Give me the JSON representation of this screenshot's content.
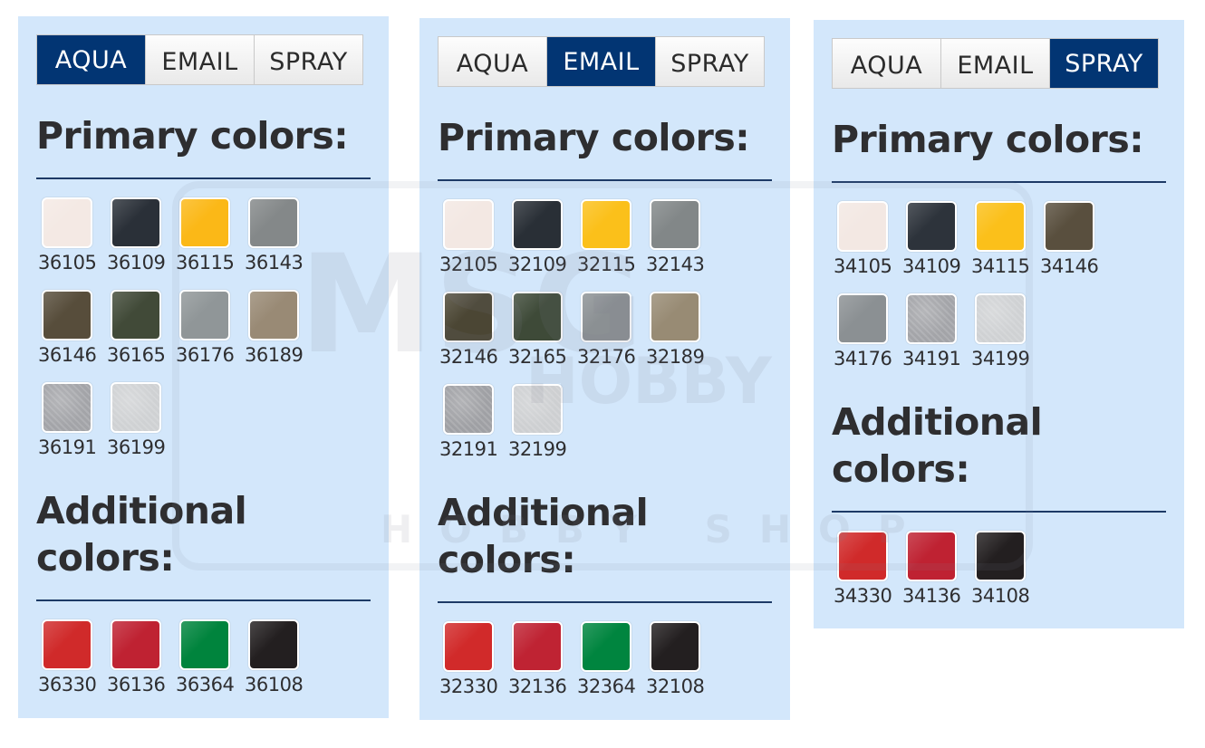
{
  "watermark": {
    "brand_top": "MSG",
    "brand_mid": "HOBBY",
    "brand_bottom": "HOBBY SHOP"
  },
  "panels": [
    {
      "tabs": [
        {
          "label": "AQUA",
          "active": true
        },
        {
          "label": "EMAIL",
          "active": false
        },
        {
          "label": "SPRAY",
          "active": false
        }
      ],
      "primary_heading": "Primary colors:",
      "additional_heading_line1": "Additional",
      "additional_heading_line2": "colors:",
      "primary": [
        {
          "code": "36105",
          "color": "#f4e9e4"
        },
        {
          "code": "36109",
          "color": "#2a3038"
        },
        {
          "code": "36115",
          "color": "#fbb817"
        },
        {
          "code": "36143",
          "color": "#848889"
        },
        {
          "code": "36146",
          "color": "#574d3b"
        },
        {
          "code": "36165",
          "color": "#414a38"
        },
        {
          "code": "36176",
          "color": "#909698"
        },
        {
          "code": "36189",
          "color": "#998a75"
        },
        {
          "code": "36191",
          "color": "#a3a4a8",
          "metallic": true
        },
        {
          "code": "36199",
          "color": "#cfd1d3",
          "metallic": true
        }
      ],
      "additional": [
        {
          "code": "36330",
          "color": "#d02a2a"
        },
        {
          "code": "36136",
          "color": "#bf2232"
        },
        {
          "code": "36364",
          "color": "#00843d"
        },
        {
          "code": "36108",
          "color": "#231f20"
        }
      ]
    },
    {
      "tabs": [
        {
          "label": "AQUA",
          "active": false
        },
        {
          "label": "EMAIL",
          "active": true
        },
        {
          "label": "SPRAY",
          "active": false
        }
      ],
      "primary_heading": "Primary colors:",
      "additional_heading_line1": "Additional",
      "additional_heading_line2": "colors:",
      "primary": [
        {
          "code": "32105",
          "color": "#f3e8e3"
        },
        {
          "code": "32109",
          "color": "#292f36"
        },
        {
          "code": "32115",
          "color": "#fbc01a"
        },
        {
          "code": "32143",
          "color": "#828788"
        },
        {
          "code": "32146",
          "color": "#4b4634"
        },
        {
          "code": "32165",
          "color": "#3e4a38"
        },
        {
          "code": "32176",
          "color": "#8b9093"
        },
        {
          "code": "32189",
          "color": "#988b74"
        },
        {
          "code": "32191",
          "color": "#9fa0a4",
          "metallic": true
        },
        {
          "code": "32199",
          "color": "#cdcfd1",
          "metallic": true
        }
      ],
      "additional": [
        {
          "code": "32330",
          "color": "#d12a2a"
        },
        {
          "code": "32136",
          "color": "#bf2333"
        },
        {
          "code": "32364",
          "color": "#00853f"
        },
        {
          "code": "32108",
          "color": "#231f20"
        }
      ]
    },
    {
      "tabs": [
        {
          "label": "AQUA",
          "active": false
        },
        {
          "label": "EMAIL",
          "active": false
        },
        {
          "label": "SPRAY",
          "active": true
        }
      ],
      "primary_heading": "Primary colors:",
      "additional_heading_line1": "Additional",
      "additional_heading_line2": "colors:",
      "primary": [
        {
          "code": "34105",
          "color": "#f3e8e3"
        },
        {
          "code": "34109",
          "color": "#2d333b"
        },
        {
          "code": "34115",
          "color": "#fbc01a"
        },
        {
          "code": "34146",
          "color": "#594f3e"
        },
        {
          "code": "34176",
          "color": "#8b9093"
        },
        {
          "code": "34191",
          "color": "#a3a4a8",
          "metallic": true
        },
        {
          "code": "34199",
          "color": "#cfd1d3",
          "metallic": true
        }
      ],
      "additional": [
        {
          "code": "34330",
          "color": "#d02a2a"
        },
        {
          "code": "34136",
          "color": "#bf2232"
        },
        {
          "code": "34108",
          "color": "#231f20"
        }
      ]
    }
  ]
}
